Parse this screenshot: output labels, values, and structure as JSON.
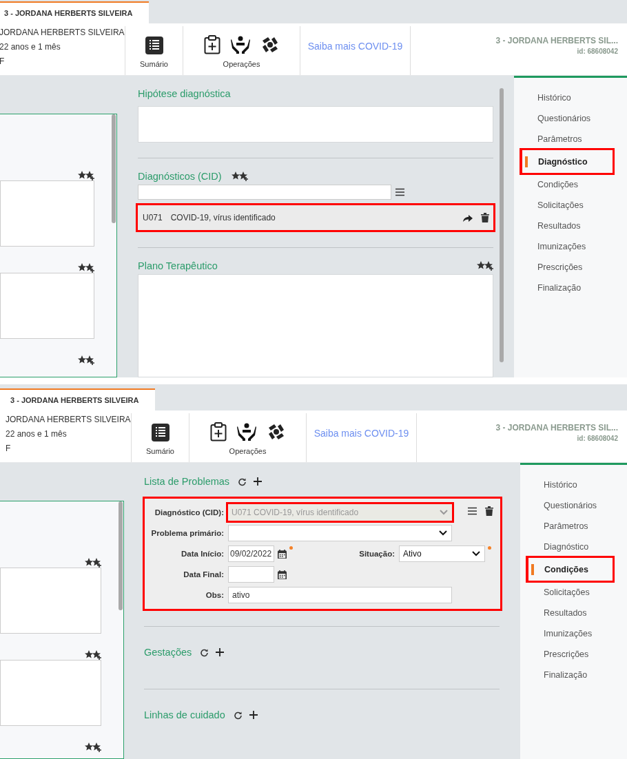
{
  "panels": [
    {
      "tab": {
        "label": "3 - JORDANA HERBERTS SILVEIRA",
        "selected": true
      },
      "patient": {
        "name": "JORDANA HERBERTS SILVEIRA",
        "age": "22 anos e 1 mês",
        "sex": "F"
      },
      "toolbar": {
        "summary_label": "Sumário",
        "operations_label": "Operações",
        "link": "Saiba mais COVID-19"
      },
      "patient_title": "3 - JORDANA HERBERTS SIL...",
      "patient_id": "id: 68608042",
      "scrollbar": true,
      "left_fields": [
        {
          "kind": "stars_textarea"
        },
        {
          "kind": "stars_textarea"
        },
        {
          "kind": "stars"
        }
      ],
      "sections": [
        {
          "kind": "textarea",
          "title": "Hipótese diagnóstica",
          "favorites": false
        },
        {
          "kind": "cid_list",
          "title": "Diagnósticos (CID)",
          "items": [
            {
              "code": "U071",
              "description": "COVID-19, vírus identificado",
              "highlighted": true
            }
          ]
        },
        {
          "kind": "textarea",
          "title": "Plano Terapêutico",
          "favorites": true
        }
      ],
      "nav": [
        {
          "label": "Histórico",
          "selected": false,
          "highlighted": false
        },
        {
          "label": "Questionários",
          "selected": false,
          "highlighted": false
        },
        {
          "label": "Parâmetros",
          "selected": false,
          "highlighted": false
        },
        {
          "label": "Diagnóstico",
          "selected": true,
          "highlighted": true
        },
        {
          "label": "Condições",
          "selected": false,
          "highlighted": false
        },
        {
          "label": "Solicitações",
          "selected": false,
          "highlighted": false
        },
        {
          "label": "Resultados",
          "selected": false,
          "highlighted": false
        },
        {
          "label": "Imunizações",
          "selected": false,
          "highlighted": false
        },
        {
          "label": "Prescrições",
          "selected": false,
          "highlighted": false
        },
        {
          "label": "Finalização",
          "selected": false,
          "highlighted": false
        }
      ]
    },
    {
      "tab": {
        "label": "3 - JORDANA HERBERTS SILVEIRA",
        "selected": true
      },
      "patient": {
        "name": "JORDANA HERBERTS SILVEIRA",
        "age": "22 anos e 1 mês",
        "sex": "F"
      },
      "toolbar": {
        "summary_label": "Sumário",
        "operations_label": "Operações",
        "link": "Saiba mais COVID-19"
      },
      "patient_title": "3 - JORDANA HERBERTS SIL...",
      "patient_id": "id: 68608042",
      "scrollbar": false,
      "left_fields": [
        {
          "kind": "stars_textarea"
        },
        {
          "kind": "stars_textarea"
        },
        {
          "kind": "stars"
        }
      ],
      "sections": [
        {
          "kind": "problem_form",
          "title": "Lista de Problemas",
          "highlighted": true,
          "fields": [
            {
              "kind": "select",
              "label": "Diagnóstico (CID):",
              "value": "U071 COVID-19, vírus identificado",
              "disabled": true,
              "highlighted": true
            },
            {
              "kind": "select",
              "label": "Problema primário:",
              "disabled": false,
              "highlighted": false
            },
            {
              "kind": "date_pair",
              "label": "Data Início:",
              "value": "09/02/2022",
              "required": true,
              "second_label": "Situação:",
              "second_value": "Ativo",
              "second_required": true
            },
            {
              "kind": "date",
              "label": "Data Final:",
              "required": false
            },
            {
              "kind": "text",
              "label": "Obs:",
              "value": "ativo"
            }
          ]
        },
        {
          "kind": "action_list",
          "title": "Gestações"
        },
        {
          "kind": "action_list",
          "title": "Linhas de cuidado"
        }
      ],
      "nav": [
        {
          "label": "Histórico",
          "selected": false,
          "highlighted": false
        },
        {
          "label": "Questionários",
          "selected": false,
          "highlighted": false
        },
        {
          "label": "Parâmetros",
          "selected": false,
          "highlighted": false
        },
        {
          "label": "Diagnóstico",
          "selected": false,
          "highlighted": false
        },
        {
          "label": "Condições",
          "selected": true,
          "highlighted": true
        },
        {
          "label": "Solicitações",
          "selected": false,
          "highlighted": false
        },
        {
          "label": "Resultados",
          "selected": false,
          "highlighted": false
        },
        {
          "label": "Imunizações",
          "selected": false,
          "highlighted": false
        },
        {
          "label": "Prescrições",
          "selected": false,
          "highlighted": false
        },
        {
          "label": "Finalização",
          "selected": false,
          "highlighted": false
        }
      ]
    }
  ]
}
